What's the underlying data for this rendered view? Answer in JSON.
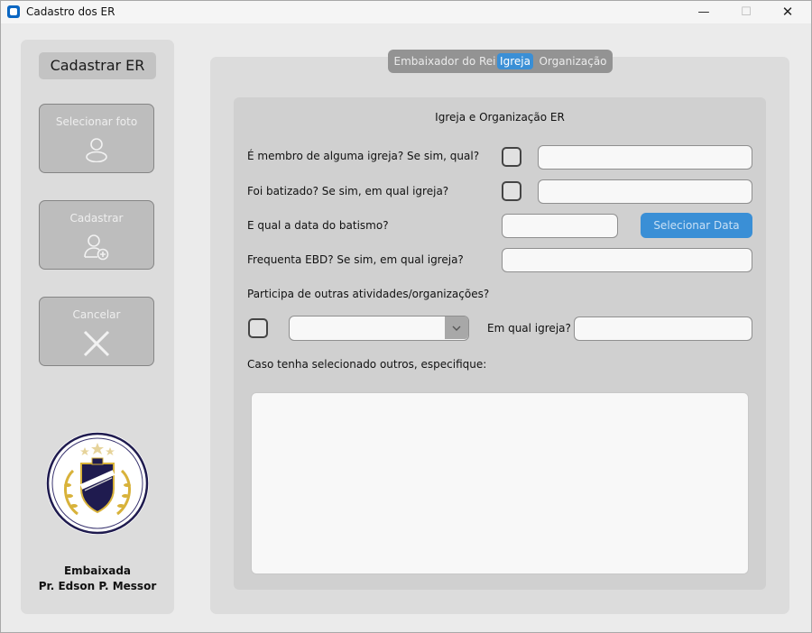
{
  "window": {
    "title": "Cadastro dos ER",
    "min_symbol": "—",
    "max_symbol": "☐",
    "close_symbol": "✕"
  },
  "sidebar": {
    "title": "Cadastrar ER",
    "select_photo_label": "Selecionar foto",
    "register_label": "Cadastrar",
    "cancel_label": "Cancelar",
    "org_line1": "Embaixada",
    "org_line2": "Pr. Edson P. Messor"
  },
  "tabs": [
    "Embaixador do Rei",
    "Igreja",
    "Organização"
  ],
  "active_tab": "Igreja",
  "section": {
    "title": "Igreja e Organização ER",
    "q_member": "É membro de alguma igreja? Se sim, qual?",
    "q_baptized": "Foi batizado? Se sim, em qual igreja?",
    "q_baptism_date": "E qual a data do batismo?",
    "select_date_label": "Selecionar Data",
    "q_ebd": "Frequenta EBD? Se sim, em qual igreja?",
    "q_activities": "Participa de outras atividades/organizações?",
    "q_which_church": "Em qual igreja?",
    "q_specify": "Caso tenha selecionado outros, especifique:"
  },
  "fields": {
    "member_church": "",
    "baptized_church": "",
    "baptism_date": "",
    "ebd_church": "",
    "activity_selected": "",
    "activity_church": "",
    "other_specify": ""
  },
  "colors": {
    "accent": "#3a8fd6",
    "panel": "#dcdcdc",
    "section": "#d0d0d0",
    "button": "#bdbdbd"
  },
  "icons": [
    "app-icon",
    "user-icon",
    "add-user-icon",
    "close-x-icon",
    "chevron-down-icon",
    "ambassador-emblem"
  ]
}
